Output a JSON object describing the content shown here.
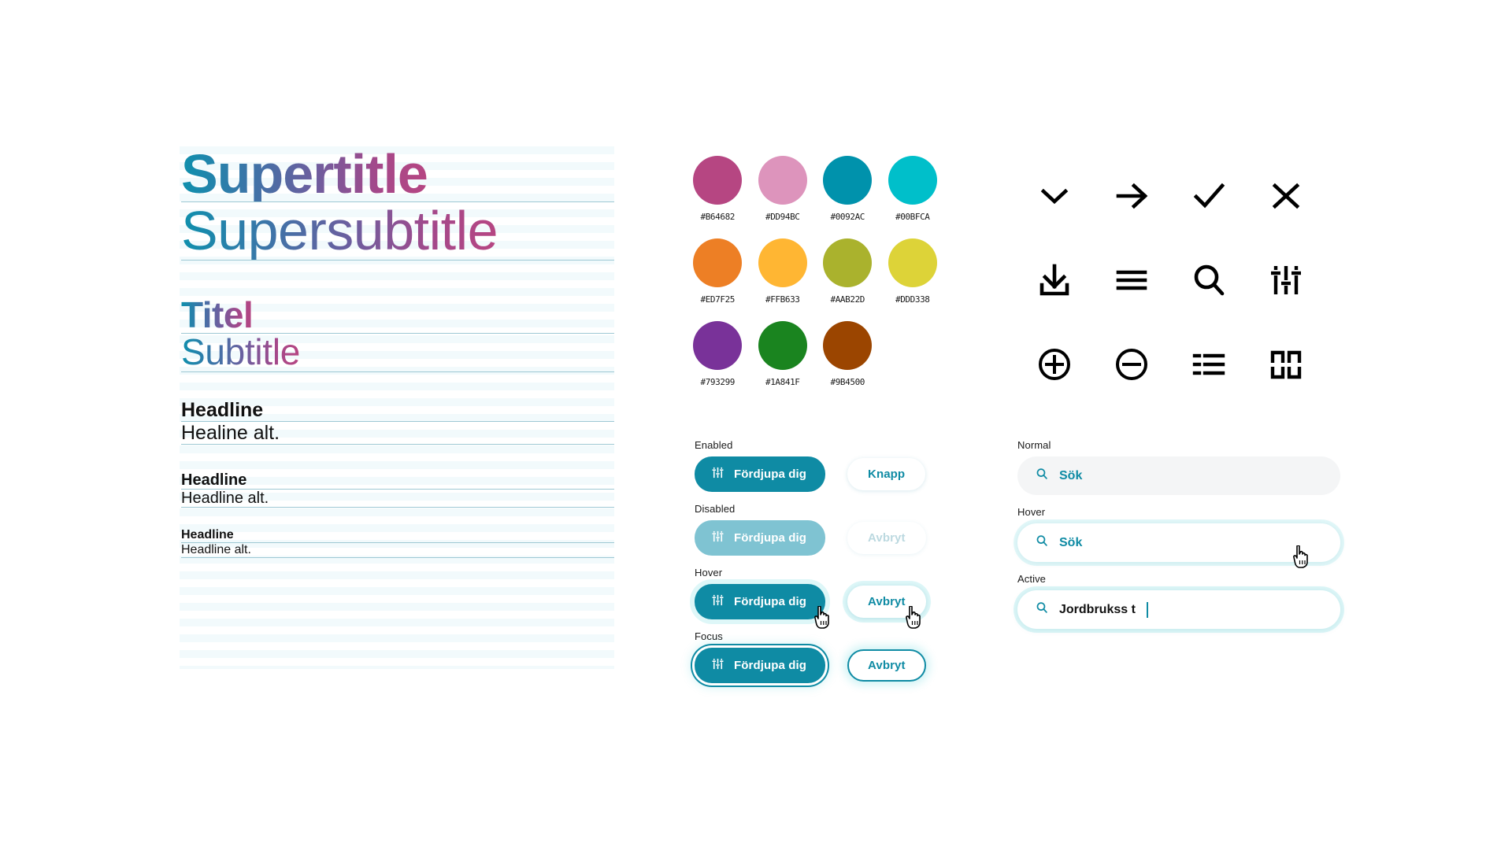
{
  "typography": {
    "rows": [
      {
        "id": "supertitle",
        "text": "Supertitle",
        "style": "supertitle"
      },
      {
        "id": "supersubtitle",
        "text": "Supersubtitle",
        "style": "supersubtitle"
      },
      {
        "id": "titel",
        "text": "Titel",
        "style": "titel"
      },
      {
        "id": "subtitle",
        "text": "Subtitle",
        "style": "subtitle"
      },
      {
        "id": "headline-1",
        "text": "Headline",
        "style": "hl1"
      },
      {
        "id": "headline-alt-1",
        "text": "Healine alt.",
        "style": "hla1"
      },
      {
        "id": "headline-2",
        "text": "Headline",
        "style": "hl2"
      },
      {
        "id": "headline-alt-2",
        "text": "Headline alt.",
        "style": "hla2"
      },
      {
        "id": "headline-3",
        "text": "Headline",
        "style": "hl3"
      },
      {
        "id": "headline-alt-3",
        "text": "Headline alt.",
        "style": "hla3"
      }
    ]
  },
  "palette": {
    "rows": [
      [
        {
          "name": "magenta",
          "hex": "#B64682"
        },
        {
          "name": "pink",
          "hex": "#DD94BC"
        },
        {
          "name": "teal",
          "hex": "#0092AC"
        },
        {
          "name": "cyan",
          "hex": "#00BFCA"
        }
      ],
      [
        {
          "name": "orange",
          "hex": "#ED7F25"
        },
        {
          "name": "amber",
          "hex": "#FFB633"
        },
        {
          "name": "olive",
          "hex": "#AAB22D"
        },
        {
          "name": "yellow",
          "hex": "#DDD338"
        }
      ],
      [
        {
          "name": "purple",
          "hex": "#793299"
        },
        {
          "name": "green",
          "hex": "#1A841F"
        },
        {
          "name": "brown",
          "hex": "#9B4500"
        }
      ]
    ]
  },
  "icons": {
    "items": [
      "chevron-down-icon",
      "arrow-right-icon",
      "check-icon",
      "close-icon",
      "download-icon",
      "menu-icon",
      "search-icon",
      "sliders-icon",
      "plus-circle-icon",
      "minus-circle-icon",
      "list-icon",
      "grid-icon"
    ]
  },
  "buttons": {
    "groups": [
      {
        "state": "Enabled",
        "primary_label": "Fördjupa dig",
        "secondary_label": "Knapp",
        "cursor": false
      },
      {
        "state": "Disabled",
        "primary_label": "Fördjupa dig",
        "secondary_label": "Avbryt",
        "cursor": false
      },
      {
        "state": "Hover",
        "primary_label": "Fördjupa dig",
        "secondary_label": "Avbryt",
        "cursor": true
      },
      {
        "state": "Focus",
        "primary_label": "Fördjupa dig",
        "secondary_label": "Avbryt",
        "cursor": false
      }
    ]
  },
  "search": {
    "groups": [
      {
        "state": "Normal",
        "value": "Sök",
        "typed": false,
        "caret": false
      },
      {
        "state": "Hover",
        "value": "Sök",
        "typed": false,
        "caret": false,
        "cursor": true
      },
      {
        "state": "Active",
        "value": "Jordbrukss t",
        "typed": true,
        "caret": true
      }
    ],
    "active_value": "Jordbrukss t"
  },
  "colors": {
    "brand_teal": "#0F8BA4",
    "brand_cyan": "#00BFCA",
    "brand_magenta": "#B64682",
    "grid_line": "#9DC8D4",
    "grid_stripe": "#F2FAFC",
    "field_bg": "#F4F5F6"
  }
}
